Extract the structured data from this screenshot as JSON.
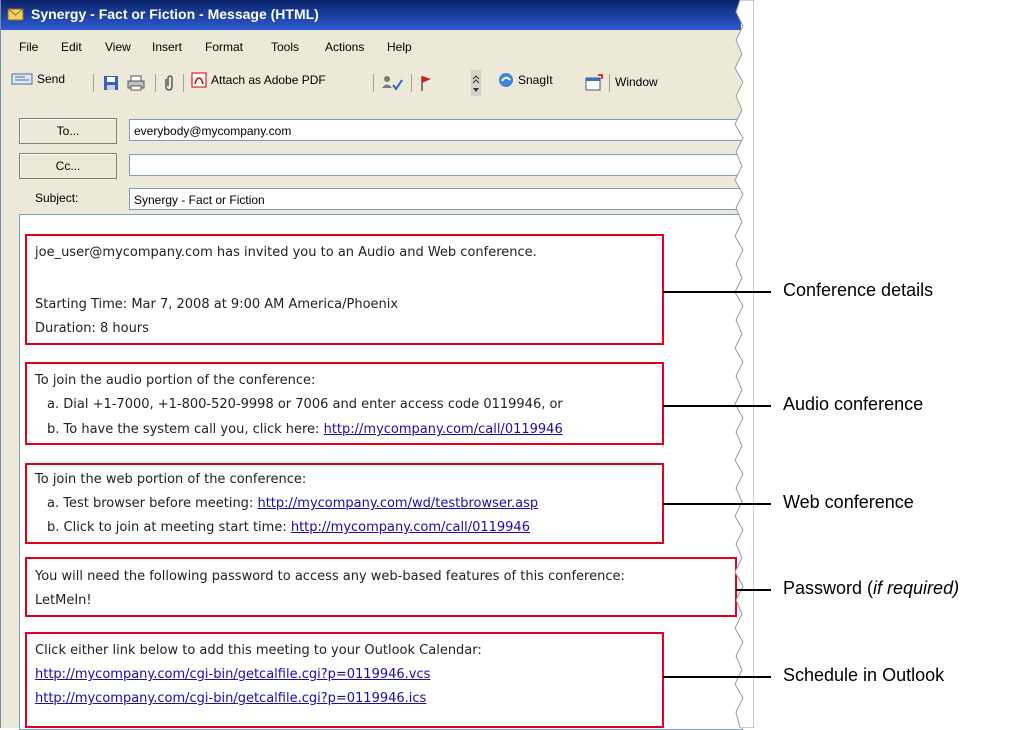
{
  "window": {
    "title": "Synergy - Fact or Fiction - Message (HTML)"
  },
  "menu": [
    "File",
    "Edit",
    "View",
    "Insert",
    "Format",
    "Tools",
    "Actions",
    "Help"
  ],
  "toolbar": {
    "send": "Send",
    "attach_pdf": "Attach as Adobe PDF",
    "snagit": "SnagIt",
    "window_field": "Window"
  },
  "header": {
    "to_label": "To...",
    "to_value": "everybody@mycompany.com",
    "cc_label": "Cc...",
    "cc_value": "",
    "subject_label": "Subject:",
    "subject_value": "Synergy - Fact or Fiction"
  },
  "body": {
    "conf_l1": "joe_user@mycompany.com has invited you to an Audio and Web conference.",
    "conf_l2": "Starting Time: Mar 7, 2008 at 9:00 AM America/Phoenix",
    "conf_l3": "Duration: 8 hours",
    "audio_l1": "To join the audio portion of the conference:",
    "audio_l2": "a. Dial +1-7000, +1-800-520-9998 or 7006 and enter access code 0119946, or",
    "audio_l3_prefix": "b. To have the system call you, click here: ",
    "audio_link": "http://mycompany.com/call/0119946",
    "web_l1": "To join the web portion of the conference:",
    "web_l2_prefix": "a. Test browser before meeting: ",
    "web_link1": "http://mycompany.com/wd/testbrowser.asp",
    "web_l3_prefix": "b. Click to join at meeting start time: ",
    "web_link2": "http://mycompany.com/call/0119946",
    "pw_l1": "You will need the following password to access any web-based features of this conference:",
    "pw_l2": "LetMeIn!",
    "sched_l1": "Click either link below to add this meeting to your Outlook Calendar:",
    "sched_link1": "http://mycompany.com/cgi-bin/getcalfile.cgi?p=0119946.vcs",
    "sched_link2": "http://mycompany.com/cgi-bin/getcalfile.cgi?p=0119946.ics"
  },
  "callouts": {
    "conference_details": "Conference details",
    "audio_conference": "Audio conference",
    "web_conference": "Web conference",
    "password_main": "Password (",
    "password_italic": "if required)",
    "schedule": "Schedule in Outlook"
  }
}
